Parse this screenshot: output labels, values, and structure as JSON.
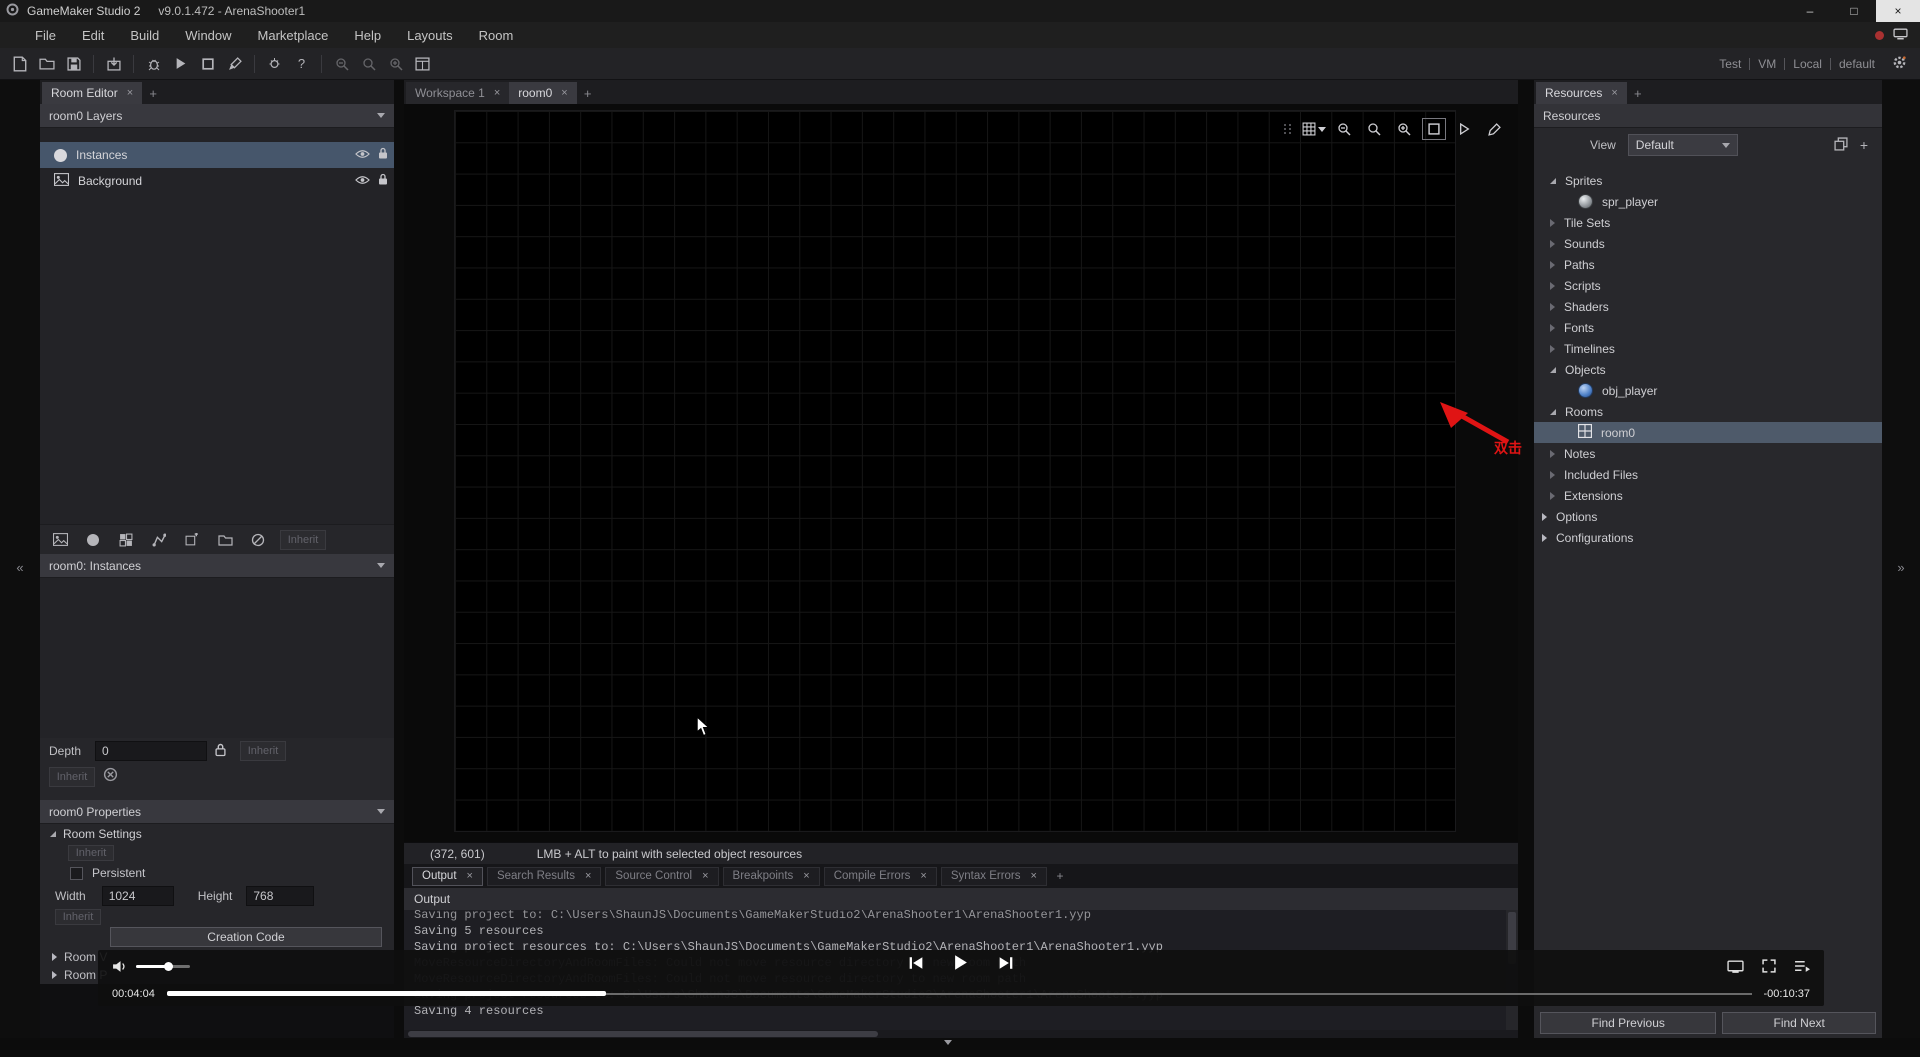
{
  "title_bar": {
    "title": "GameMaker Studio 2",
    "subtitle": "v9.0.1.472 - ArenaShooter1"
  },
  "icons": {
    "close": "×",
    "add": "+",
    "minimize": "–",
    "maximize": "□",
    "collapse_left": "«",
    "collapse_right": "»",
    "help": "?"
  },
  "menu": {
    "items": [
      "File",
      "Edit",
      "Build",
      "Window",
      "Marketplace",
      "Help",
      "Layouts",
      "Room"
    ]
  },
  "toolbar": {
    "status_segments": [
      "Test",
      "VM",
      "Local",
      "default"
    ]
  },
  "left_panel": {
    "tab": "Room Editor",
    "layers_header": "room0 Layers",
    "layers": [
      {
        "name": "Instances",
        "selected": true
      },
      {
        "name": "Background",
        "selected": false
      }
    ],
    "inherit_label": "Inherit",
    "instances_header": "room0: Instances",
    "depth": {
      "label": "Depth",
      "value": "0",
      "inherit": "Inherit"
    },
    "inherit2": "Inherit",
    "properties_header": "room0 Properties",
    "room_settings_label": "Room Settings",
    "settings_inherit": "Inherit",
    "persistent_label": "Persistent",
    "persistent_checked": false,
    "width_label": "Width",
    "width_value": "1024",
    "height_label": "Height",
    "height_value": "768",
    "bottom_inherit": "Inherit",
    "creation_code_label": "Creation Code",
    "collapsed_sections": [
      {
        "label": "Room V"
      },
      {
        "label": "Room P"
      }
    ]
  },
  "workspace": {
    "tabs": [
      {
        "label": "Workspace 1",
        "active": false
      },
      {
        "label": "room0",
        "active": true
      }
    ],
    "status_coords": "(372, 601)",
    "status_hint": "LMB + ALT to paint with selected object resources"
  },
  "output_panel": {
    "tabs": [
      {
        "label": "Output",
        "active": true
      },
      {
        "label": "Search Results",
        "active": false
      },
      {
        "label": "Source Control",
        "active": false
      },
      {
        "label": "Breakpoints",
        "active": false
      },
      {
        "label": "Compile Errors",
        "active": false
      },
      {
        "label": "Syntax Errors",
        "active": false
      }
    ],
    "header": "Output",
    "log_lines": [
      {
        "text": "Saving project to: C:\\Users\\ShaunJS\\Documents\\GameMakerStudio2\\ArenaShooter1\\ArenaShooter1.yyp",
        "dim": false
      },
      {
        "text": "Saving 5 resources",
        "dim": false
      },
      {
        "text": "Saving project resources to: C:\\Users\\ShaunJS\\Documents\\GameMakerStudio2\\ArenaShooter1\\ArenaShooter1.yyp",
        "dim": false
      },
      {
        "text": "MoveResourceDirectoryAndRoomFiles: Could not move resource directory to new room path",
        "dim": true
      },
      {
        "text": "MoveResourceDirectoryAndRoomFiles: Could not move resource directory to new room path",
        "dim": true
      },
      {
        "text": "Saving project resources to: C:\\Users\\ShaunJS\\Documents\\GameMakerStudio2\\ArenaShooter1\\ArenaShooter1.yyp",
        "dim": true
      },
      {
        "text": "Saving 4 resources",
        "dim": false
      }
    ],
    "find_previous": "Find Previous",
    "find_next": "Find Next"
  },
  "resources_panel": {
    "tab": "Resources",
    "header": "Resources",
    "view_label": "View",
    "view_value": "Default",
    "tree": [
      {
        "label": "Sprites",
        "type": "group-expanded"
      },
      {
        "label": "spr_player",
        "type": "sprite-item"
      },
      {
        "label": "Tile Sets",
        "type": "group"
      },
      {
        "label": "Sounds",
        "type": "group"
      },
      {
        "label": "Paths",
        "type": "group"
      },
      {
        "label": "Scripts",
        "type": "group"
      },
      {
        "label": "Shaders",
        "type": "group"
      },
      {
        "label": "Fonts",
        "type": "group"
      },
      {
        "label": "Timelines",
        "type": "group"
      },
      {
        "label": "Objects",
        "type": "group-expanded"
      },
      {
        "label": "obj_player",
        "type": "object-item"
      },
      {
        "label": "Rooms",
        "type": "group-expanded"
      },
      {
        "label": "room0",
        "type": "room-item",
        "selected": true
      },
      {
        "label": "Notes",
        "type": "group"
      },
      {
        "label": "Included Files",
        "type": "group"
      },
      {
        "label": "Extensions",
        "type": "group"
      },
      {
        "label": "Options",
        "type": "shallow-group"
      },
      {
        "label": "Configurations",
        "type": "shallow-group"
      }
    ]
  },
  "media_player": {
    "elapsed": "00:04:04",
    "remaining": "-00:10:37",
    "progress_percent": 27.7,
    "volume_percent": 58
  },
  "annotation": {
    "text": "双击",
    "color": "#e01414"
  },
  "colors": {
    "selection": "#46566b",
    "tree_selection": "#4e5a6a",
    "annotation_red": "#e01414"
  }
}
